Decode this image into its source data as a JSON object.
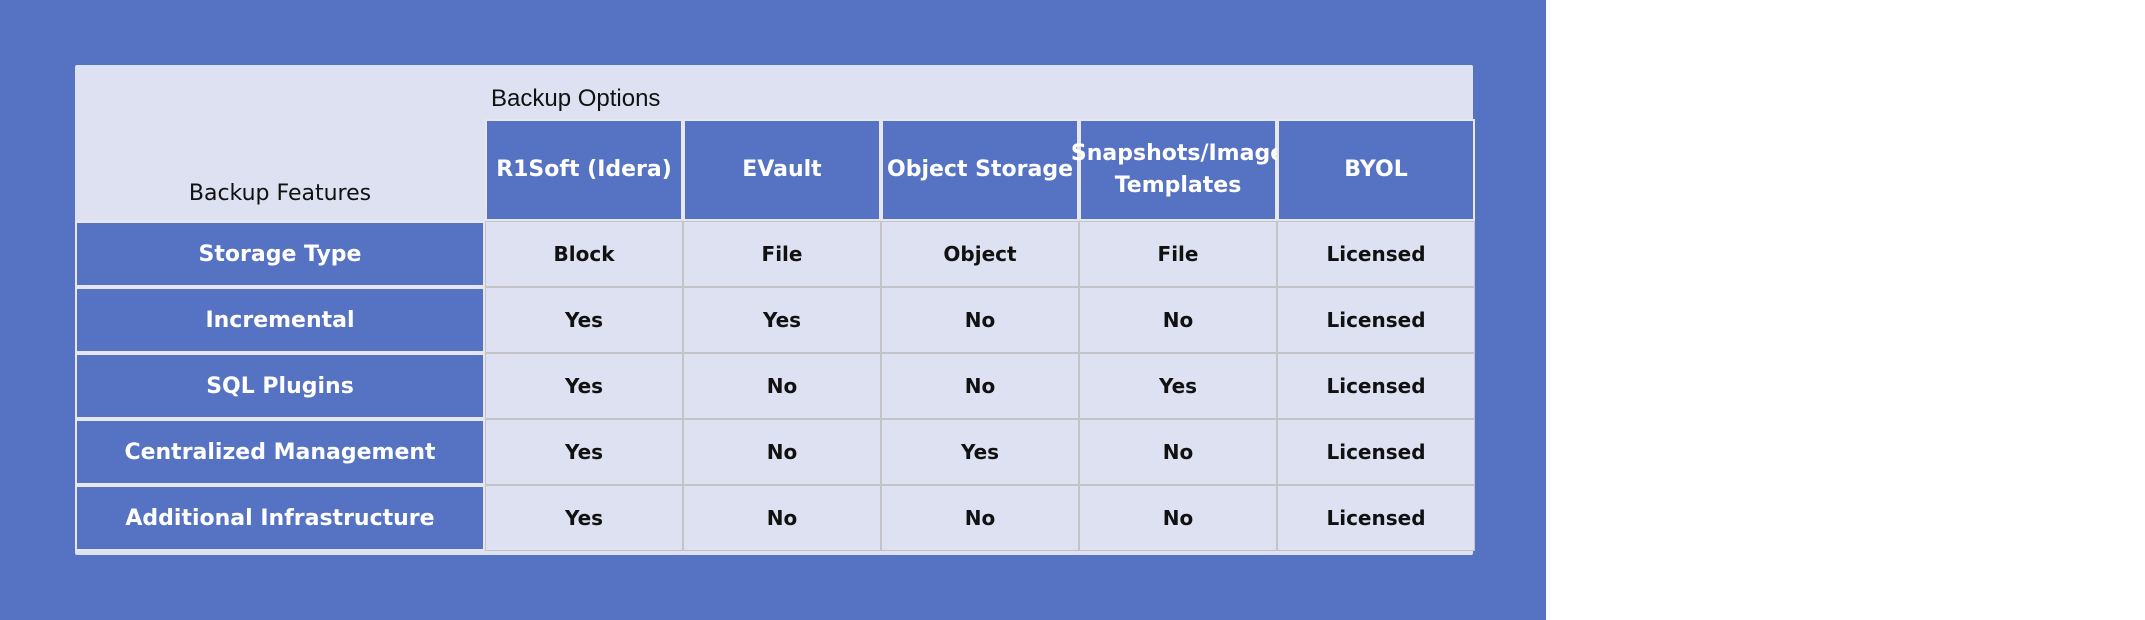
{
  "header": {
    "options_title": "Backup Options",
    "features_title": "Backup Features"
  },
  "columns": [
    "R1Soft (Idera)",
    "EVault",
    "Object Storage",
    "Snapshots/Image Templates",
    "BYOL"
  ],
  "rows": [
    {
      "label": "Storage Type",
      "values": [
        "Block",
        "File",
        "Object",
        "File",
        "Licensed"
      ]
    },
    {
      "label": "Incremental",
      "values": [
        "Yes",
        "Yes",
        "No",
        "No",
        "Licensed"
      ]
    },
    {
      "label": "SQL Plugins",
      "values": [
        "Yes",
        "No",
        "No",
        "Yes",
        "Licensed"
      ]
    },
    {
      "label": "Centralized Management",
      "values": [
        "Yes",
        "No",
        "Yes",
        "No",
        "Licensed"
      ]
    },
    {
      "label": "Additional Infrastructure",
      "values": [
        "Yes",
        "No",
        "No",
        "No",
        "Licensed"
      ]
    }
  ],
  "colors": {
    "background": "#5672c2",
    "table_fill": "#dde1f1",
    "header_fill": "#5672c2",
    "header_text": "#ffffff",
    "cell_text": "#111111"
  }
}
